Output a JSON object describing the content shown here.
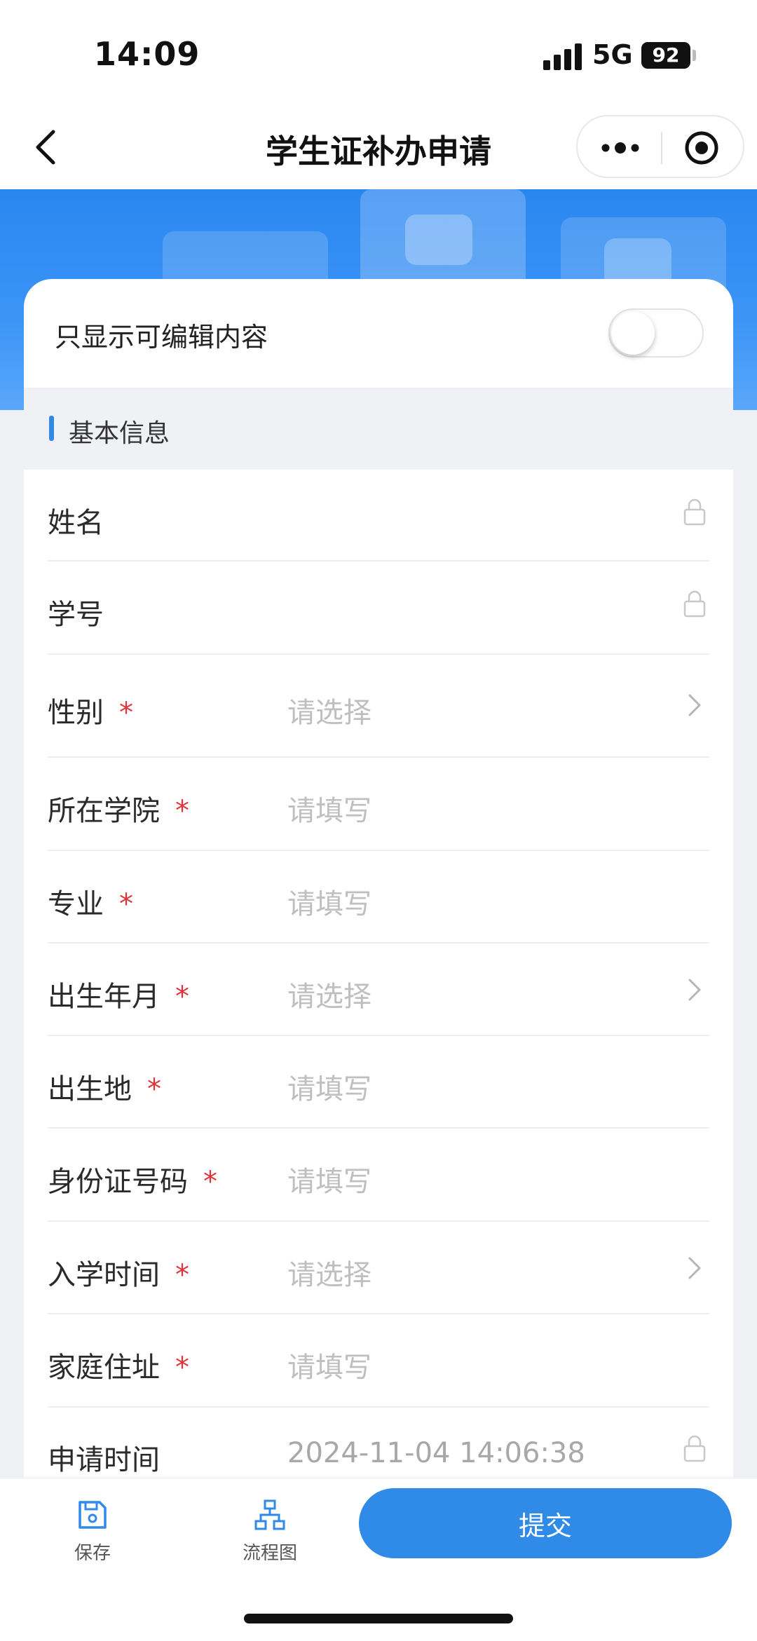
{
  "status": {
    "time": "14:09",
    "network": "5G",
    "battery": "92"
  },
  "nav": {
    "title": "学生证补办申请"
  },
  "toggle": {
    "label": "只显示可编辑内容",
    "on": false
  },
  "section": {
    "title": "基本信息"
  },
  "fields": [
    {
      "label": "姓名",
      "required": false,
      "value": "",
      "placeholder": "",
      "kind": "locked"
    },
    {
      "label": "学号",
      "required": false,
      "value": "",
      "placeholder": "",
      "kind": "locked"
    },
    {
      "label": "性别",
      "required": true,
      "value": "",
      "placeholder": "请选择",
      "kind": "select"
    },
    {
      "label": "所在学院",
      "required": true,
      "value": "",
      "placeholder": "请填写",
      "kind": "text"
    },
    {
      "label": "专业",
      "required": true,
      "value": "",
      "placeholder": "请填写",
      "kind": "text"
    },
    {
      "label": "出生年月",
      "required": true,
      "value": "",
      "placeholder": "请选择",
      "kind": "select"
    },
    {
      "label": "出生地",
      "required": true,
      "value": "",
      "placeholder": "请填写",
      "kind": "text"
    },
    {
      "label": "身份证号码",
      "required": true,
      "value": "",
      "placeholder": "请填写",
      "kind": "text"
    },
    {
      "label": "入学时间",
      "required": true,
      "value": "",
      "placeholder": "请选择",
      "kind": "select"
    },
    {
      "label": "家庭住址",
      "required": true,
      "value": "",
      "placeholder": "请填写",
      "kind": "text"
    },
    {
      "label": "申请时间",
      "required": false,
      "value": "2024-11-04 14:06:38",
      "placeholder": "",
      "kind": "locked"
    }
  ],
  "required_mark": "*",
  "bottom": {
    "save_label": "保存",
    "flow_label": "流程图",
    "submit_label": "提交"
  },
  "colors": {
    "primary": "#2f8ae8",
    "required": "#e2333a",
    "placeholder": "#bfbfbf"
  }
}
